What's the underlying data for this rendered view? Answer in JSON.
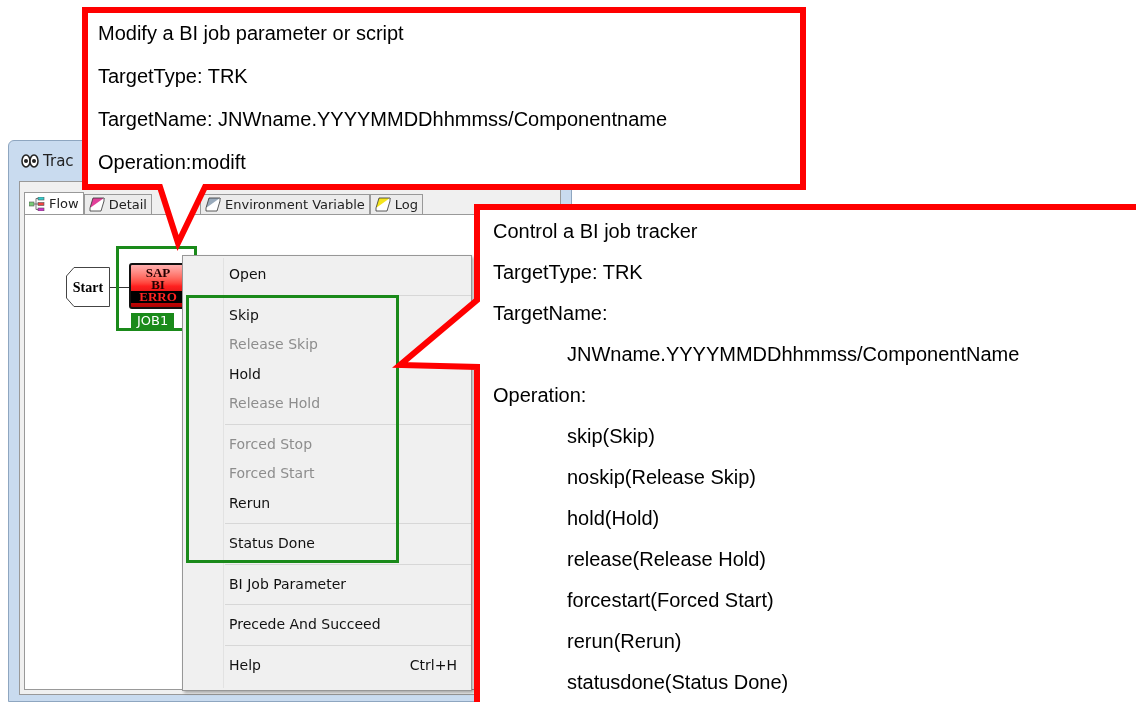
{
  "window": {
    "title": "Trac"
  },
  "tabs": [
    {
      "label": "Flow",
      "selected": true,
      "kind": "flow"
    },
    {
      "label": "Detail",
      "selected": false,
      "kind": "detail"
    },
    {
      "label": "Environment Variable",
      "selected": false,
      "kind": "env"
    },
    {
      "label": "Log",
      "selected": false,
      "kind": "log"
    }
  ],
  "flow": {
    "start_node": "Start",
    "job_node": {
      "icon_lines": [
        "SAP",
        "BI",
        "ERRO"
      ],
      "label": "JOB1",
      "selected": true
    }
  },
  "context_menu": {
    "groups": [
      [
        {
          "label": "Open",
          "disabled": false
        }
      ],
      [
        {
          "label": "Skip",
          "disabled": false
        },
        {
          "label": "Release Skip",
          "disabled": true
        },
        {
          "label": "Hold",
          "disabled": false
        },
        {
          "label": "Release Hold",
          "disabled": true
        }
      ],
      [
        {
          "label": "Forced Stop",
          "disabled": true
        },
        {
          "label": "Forced Start",
          "disabled": true
        },
        {
          "label": "Rerun",
          "disabled": false
        }
      ],
      [
        {
          "label": "Status Done",
          "disabled": false
        }
      ],
      [
        {
          "label": "BI Job Parameter",
          "disabled": false
        }
      ],
      [
        {
          "label": "Precede And Succeed",
          "disabled": false
        }
      ],
      [
        {
          "label": "Help",
          "disabled": false,
          "shortcut": "Ctrl+H"
        }
      ]
    ]
  },
  "callouts": [
    {
      "lines": [
        {
          "text": "Modify a BI job parameter or script",
          "indented": false
        },
        {
          "text": "TargetType: TRK",
          "indented": false
        },
        {
          "text": "TargetName: JNWname.YYYYMMDDhhmmss/Componentname",
          "indented": false
        },
        {
          "text": "Operation:modift",
          "indented": false
        }
      ]
    },
    {
      "lines": [
        {
          "text": "Control a BI job tracker",
          "indented": false
        },
        {
          "text": "TargetType: TRK",
          "indented": false
        },
        {
          "text": "TargetName:",
          "indented": false
        },
        {
          "text": "JNWname.YYYYMMDDhhmmss/ComponentName",
          "indented": true
        },
        {
          "text": "Operation:",
          "indented": false
        },
        {
          "text": "skip(Skip)",
          "indented": true
        },
        {
          "text": "noskip(Release Skip)",
          "indented": true
        },
        {
          "text": "hold(Hold)",
          "indented": true
        },
        {
          "text": "release(Release Hold)",
          "indented": true
        },
        {
          "text": "forcestart(Forced Start)",
          "indented": true
        },
        {
          "text": "rerun(Rerun)",
          "indented": true
        },
        {
          "text": "statusdone(Status Done)",
          "indented": true
        }
      ]
    }
  ]
}
